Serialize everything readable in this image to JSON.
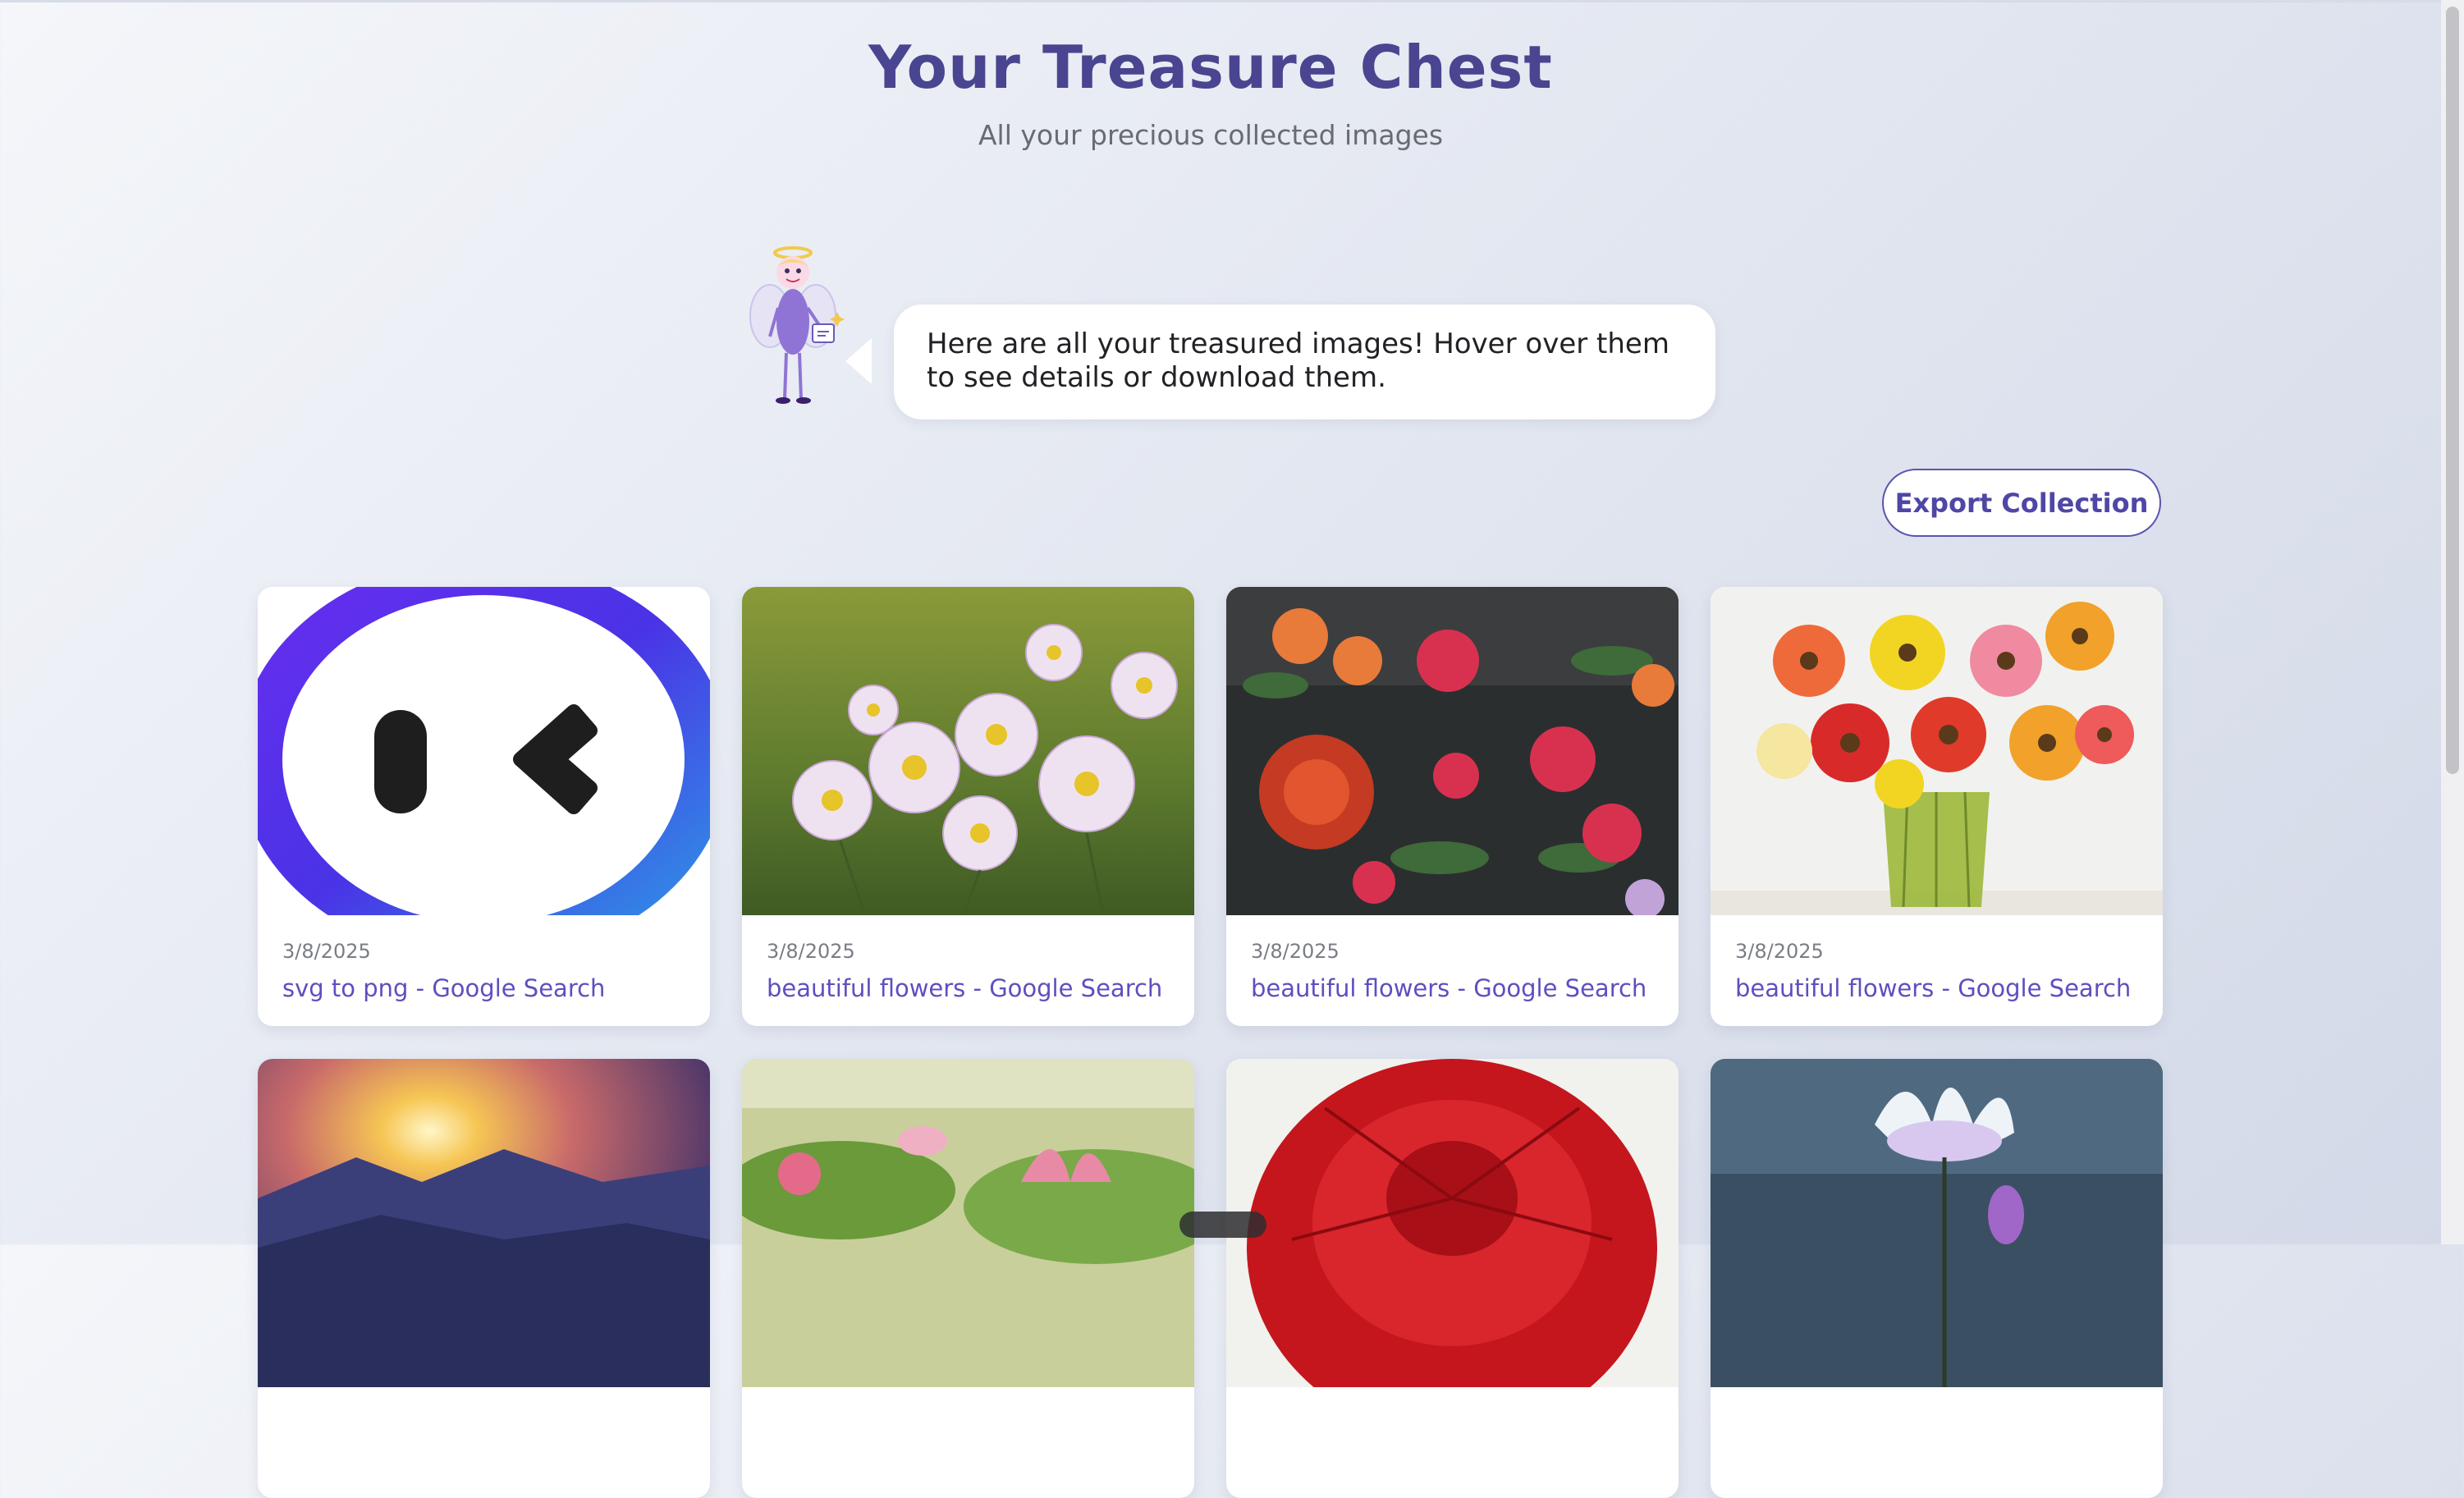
{
  "header": {
    "title": "Your Treasure Chest",
    "subtitle": "All your precious collected images"
  },
  "assistant": {
    "message": "Here are all your treasured images! Hover over them to see details or download them.",
    "mascot_icon": "angel-mascot-icon"
  },
  "toolbar": {
    "export_label": "Export Collection"
  },
  "gallery": {
    "items": [
      {
        "date": "3/8/2025",
        "title": "svg to png - Google Search",
        "image": "app-logo-face"
      },
      {
        "date": "3/8/2025",
        "title": "beautiful flowers - Google Search",
        "image": "pink-anemones"
      },
      {
        "date": "3/8/2025",
        "title": "beautiful flowers - Google Search",
        "image": "dark-rose-bouquet"
      },
      {
        "date": "3/8/2025",
        "title": "beautiful flowers - Google Search",
        "image": "gerbera-bouquet"
      },
      {
        "image": "mountain-sunset"
      },
      {
        "image": "pink-lotus"
      },
      {
        "image": "red-dahlia"
      },
      {
        "image": "white-water-lily"
      }
    ]
  },
  "colors": {
    "accent": "#4e47a6",
    "title": "#4a4590",
    "link": "#5d4fc0"
  }
}
